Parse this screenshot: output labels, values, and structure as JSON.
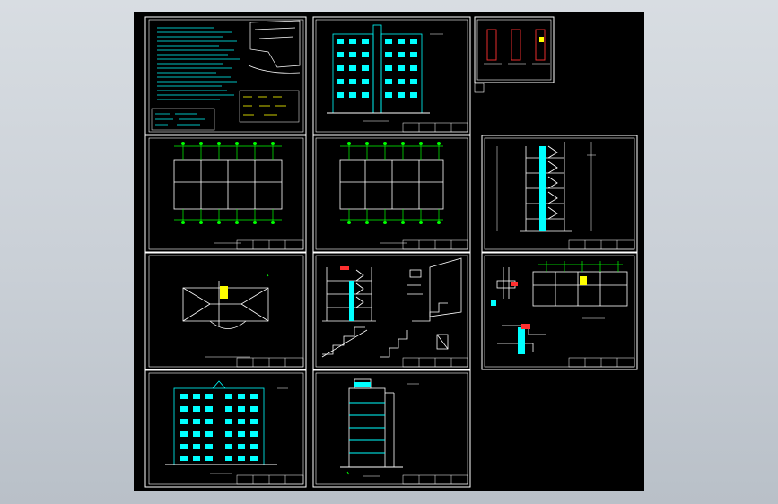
{
  "app": {
    "background_color": "#c9cfd6",
    "drawing_background": "#000000"
  },
  "drawing": {
    "description_labels": [],
    "colors": {
      "line": "#ffffff",
      "cyan": "#00ffff",
      "green": "#00ff00",
      "red": "#ff3030",
      "yellow": "#ffff00",
      "magenta": "#ff00ff"
    }
  }
}
